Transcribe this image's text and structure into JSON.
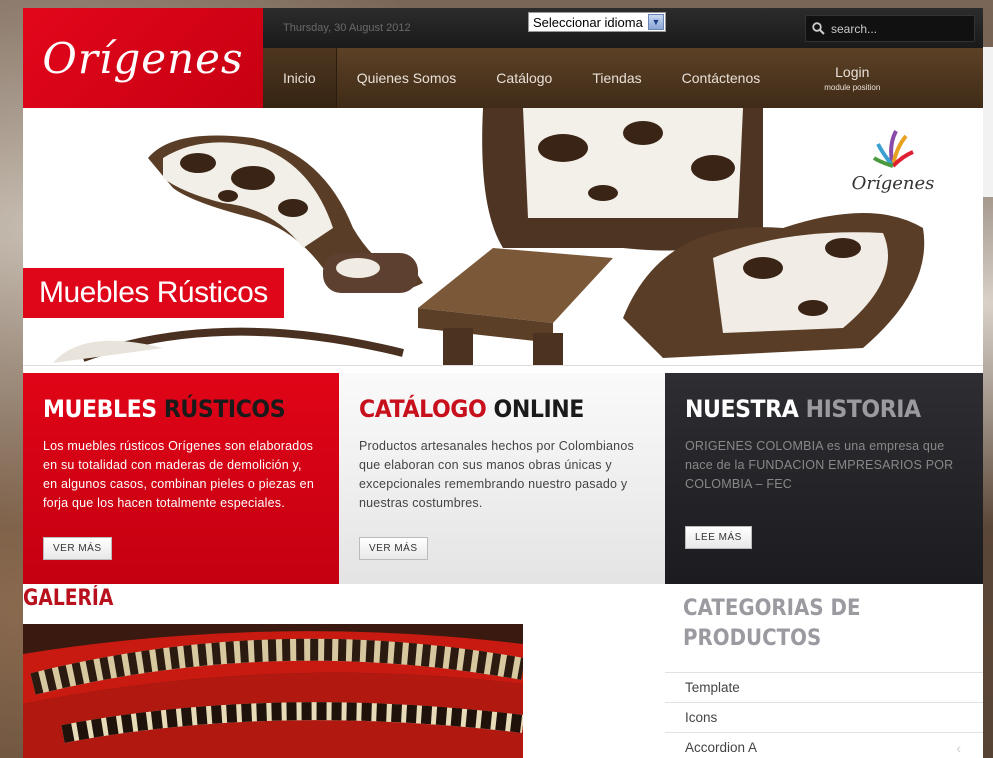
{
  "brand": {
    "logo_text": "Orígenes",
    "colors": {
      "red": "#e0061a",
      "brown": "#4f3620",
      "dark": "#222222"
    }
  },
  "topbar": {
    "date": "Thursday, 30 August 2012",
    "language_select": "Seleccionar idioma",
    "search_placeholder": "search..."
  },
  "nav": [
    {
      "label": "Inicio"
    },
    {
      "label": "Quienes Somos"
    },
    {
      "label": "Catálogo"
    },
    {
      "label": "Tiendas"
    },
    {
      "label": "Contáctenos"
    },
    {
      "label": "Login",
      "sub": "module position"
    }
  ],
  "hero": {
    "title": "Muebles Rústicos",
    "logo_text": "Orígenes"
  },
  "features": [
    {
      "title_a": "MUEBLES",
      "title_b": "RÚSTICOS",
      "text": "Los muebles rústicos Orígenes son elaborados en su totalidad con maderas de demolición y, en algunos casos, combinan pieles o piezas en forja que los hacen totalmente especiales.",
      "button": "VER MÁS"
    },
    {
      "title_a": "CATÁLOGO",
      "title_b": "ONLINE",
      "text": "Productos artesanales hechos por Colombianos que elaboran con sus manos obras únicas y excepcionales remembrando nuestro pasado y nuestras costumbres.",
      "button": "VER MÁS"
    },
    {
      "title_a": "NUESTRA",
      "title_b": "HISTORIA",
      "text": "ORIGENES COLOMBIA es una empresa que nace de la FUNDACION EMPRESARIOS POR COLOMBIA – FEC",
      "button": "LEE MÁS"
    }
  ],
  "gallery": {
    "title": "GALERÍA"
  },
  "categories": {
    "title": "CATEGORIAS DE PRODUCTOS",
    "items": [
      "Template",
      "Icons",
      "Accordion A"
    ]
  }
}
